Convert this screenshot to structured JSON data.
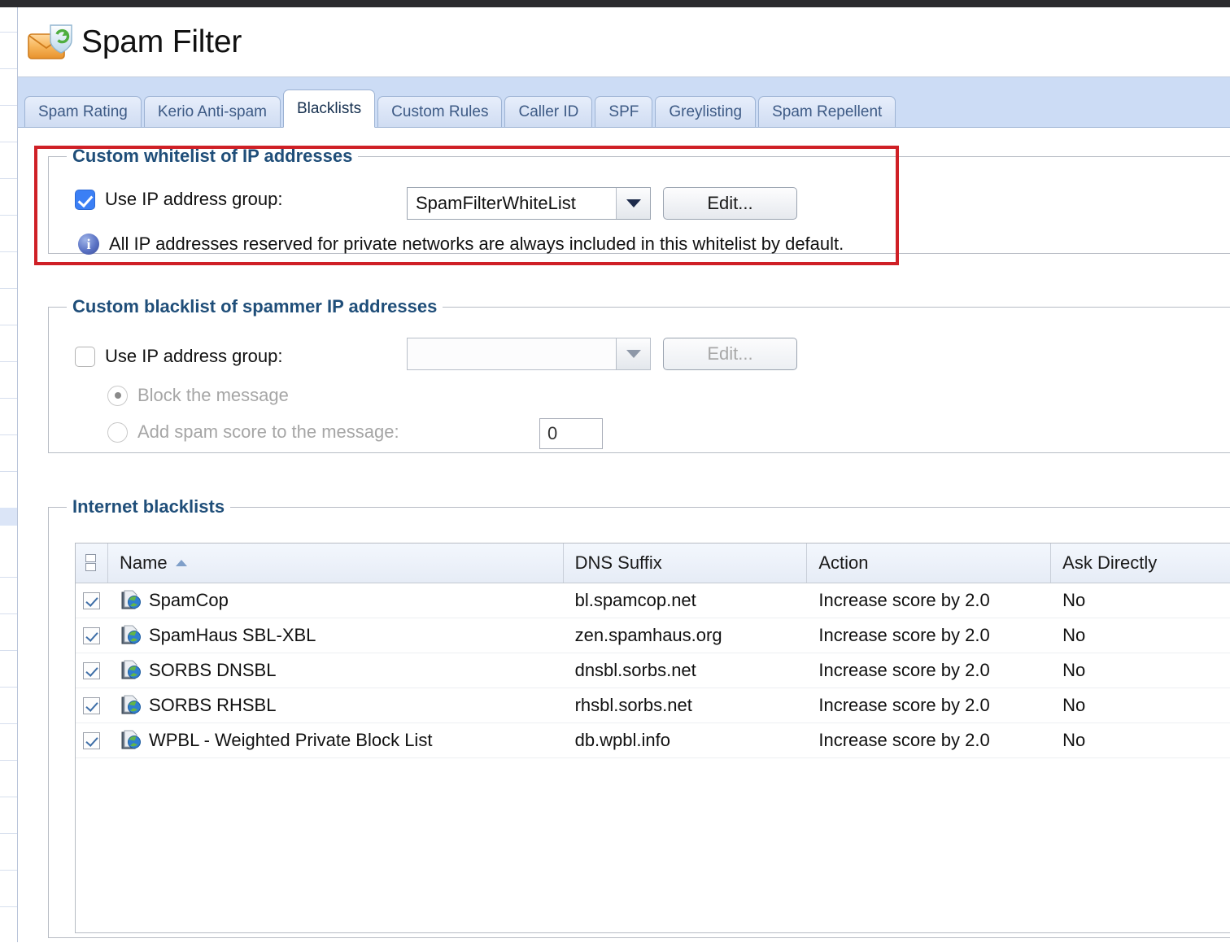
{
  "window": {
    "title": "Spam Filter",
    "app_icon": "spam-filter-envelope-icon"
  },
  "tabs": [
    {
      "label": "Spam Rating",
      "active": false
    },
    {
      "label": "Kerio Anti-spam",
      "active": false
    },
    {
      "label": "Blacklists",
      "active": true
    },
    {
      "label": "Custom Rules",
      "active": false
    },
    {
      "label": "Caller ID",
      "active": false
    },
    {
      "label": "SPF",
      "active": false
    },
    {
      "label": "Greylisting",
      "active": false
    },
    {
      "label": "Spam Repellent",
      "active": false
    }
  ],
  "whitelist": {
    "legend": "Custom whitelist of IP addresses",
    "use_group_label": "Use IP address group:",
    "use_group_checked": true,
    "group_value": "SpamFilterWhiteList",
    "edit_label": "Edit...",
    "info_glyph": "i",
    "info_text": "All IP addresses reserved for private networks are always included in this whitelist by default.",
    "highlight_color": "#cf2026"
  },
  "blacklist": {
    "legend": "Custom blacklist of spammer IP addresses",
    "use_group_label": "Use IP address group:",
    "use_group_checked": false,
    "group_value": "",
    "edit_label": "Edit...",
    "block_label": "Block the message",
    "block_selected": true,
    "score_label": "Add spam score to the message:",
    "score_selected": false,
    "score_value": "0"
  },
  "internet_blacklists": {
    "legend": "Internet blacklists",
    "columns": [
      {
        "key": "name",
        "label": "Name",
        "sorted": true,
        "sort_dir": "asc"
      },
      {
        "key": "dns",
        "label": "DNS Suffix"
      },
      {
        "key": "action",
        "label": "Action"
      },
      {
        "key": "ask",
        "label": "Ask Directly"
      }
    ],
    "rows": [
      {
        "checked": true,
        "name": "SpamCop",
        "dns": "bl.spamcop.net",
        "action": "Increase score by 2.0",
        "ask": "No"
      },
      {
        "checked": true,
        "name": "SpamHaus SBL-XBL",
        "dns": "zen.spamhaus.org",
        "action": "Increase score by 2.0",
        "ask": "No"
      },
      {
        "checked": true,
        "name": "SORBS DNSBL",
        "dns": "dnsbl.sorbs.net",
        "action": "Increase score by 2.0",
        "ask": "No"
      },
      {
        "checked": true,
        "name": "SORBS RHSBL",
        "dns": "rhsbl.sorbs.net",
        "action": "Increase score by 2.0",
        "ask": "No"
      },
      {
        "checked": true,
        "name": "WPBL - Weighted Private Block List",
        "dns": "db.wpbl.info",
        "action": "Increase score by 2.0",
        "ask": "No"
      }
    ]
  },
  "colors": {
    "tab_bar": "#ccdcf5",
    "legend_text": "#1f4e79",
    "highlight": "#cf2026",
    "checkbox_on": "#3b7ff5"
  }
}
